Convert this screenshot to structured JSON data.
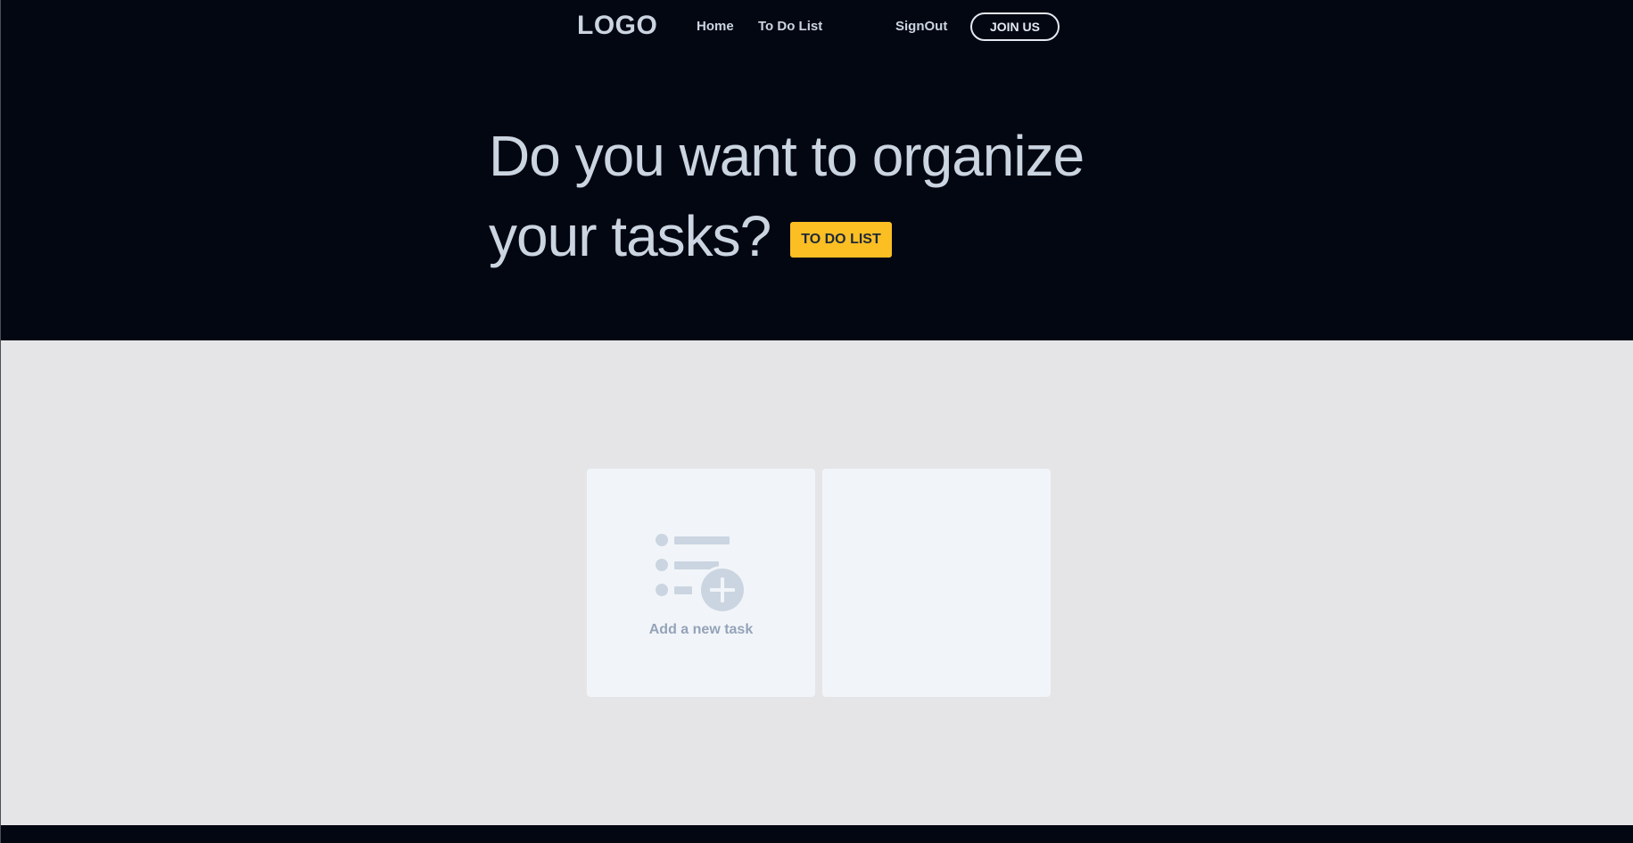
{
  "nav": {
    "logo": "LOGO",
    "links": {
      "home": "Home",
      "todo": "To Do List",
      "signout": "SignOut"
    },
    "join_label": "JOIN US"
  },
  "hero": {
    "headline_line1": "Do you want to organize",
    "headline_line2": "your tasks?",
    "cta_label": "TO DO LIST"
  },
  "cards": {
    "add_task_label": "Add a new task",
    "add_task_icon": "list-add-icon"
  },
  "colors": {
    "hero_bg": "#030712",
    "page_bg": "#e5e5e7",
    "accent": "#fbbf24",
    "card_bg": "#f1f5f9",
    "muted_icon": "#cbd5e1",
    "muted_text": "#94a3b8"
  }
}
